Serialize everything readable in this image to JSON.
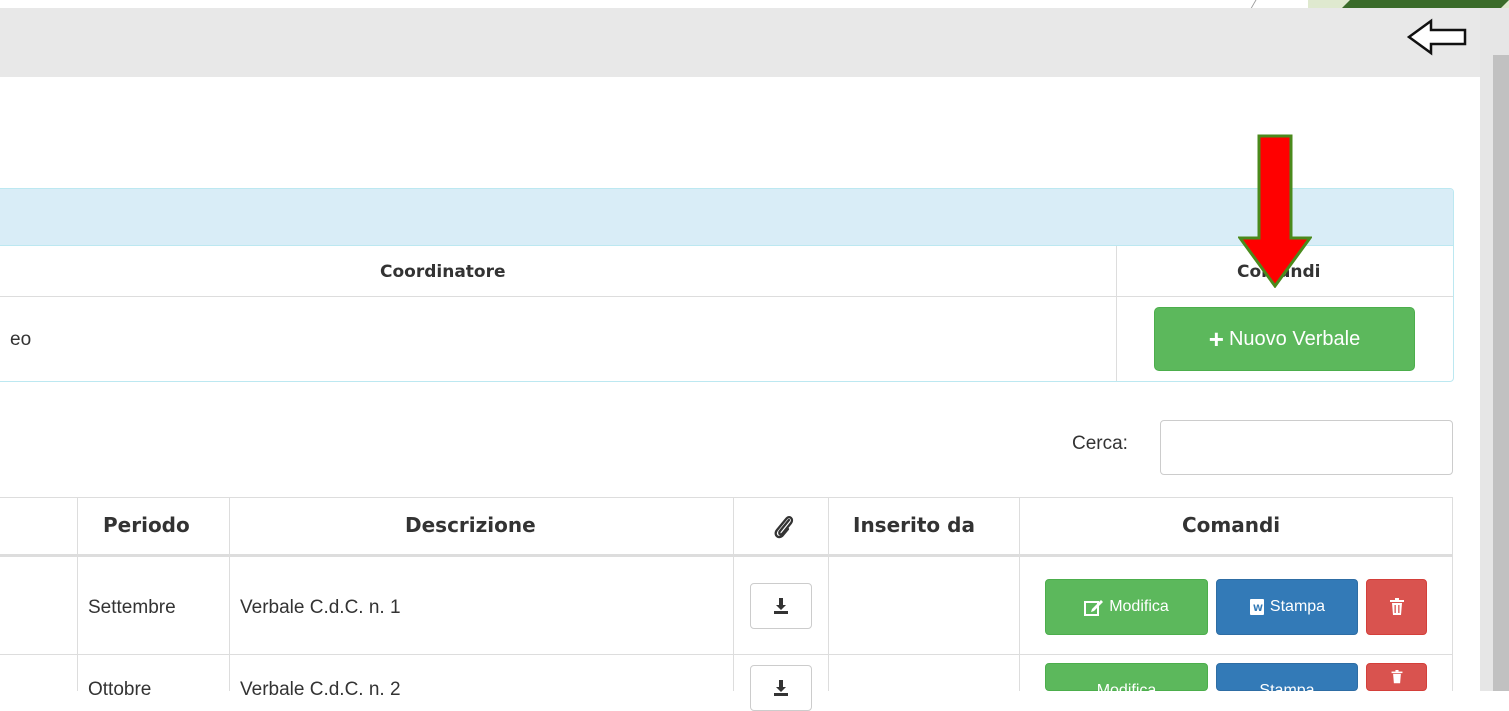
{
  "header": {
    "back_icon": "arrow-left-outline-icon"
  },
  "panel": {
    "columns": [
      "Coordinatore",
      "Comandi"
    ],
    "row_partial_text": "eo",
    "new_button_label": "Nuovo Verbale",
    "new_button_icon": "plus-icon"
  },
  "annotation": {
    "arrow_color": "#ff0000",
    "arrow_border": "#4a8a1c"
  },
  "search": {
    "label": "Cerca:",
    "value": ""
  },
  "table": {
    "columns": {
      "periodo": "Periodo",
      "descrizione": "Descrizione",
      "attachment_icon": "paperclip-icon",
      "inserito": "Inserito da",
      "comandi": "Comandi"
    },
    "rows": [
      {
        "periodo": "Settembre",
        "descrizione": "Verbale C.d.C. n. 1",
        "inserito": ""
      },
      {
        "periodo": "Ottobre",
        "descrizione": "Verbale C.d.C. n. 2",
        "inserito": ""
      }
    ],
    "actions": {
      "edit": "Modifica",
      "print": "Stampa",
      "delete_icon": "trash-icon"
    }
  },
  "colors": {
    "success": "#5cb85c",
    "primary": "#337ab7",
    "danger": "#d9534f",
    "panel_heading": "#d9edf7"
  }
}
